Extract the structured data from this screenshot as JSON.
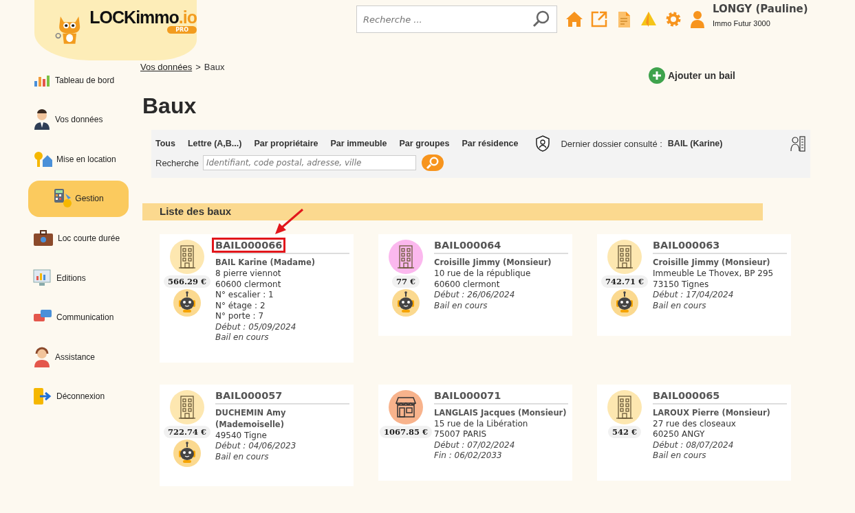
{
  "header": {
    "logo": {
      "brand": "LOCKimmo",
      "suffix": ".io",
      "badge": "PRO"
    },
    "search": {
      "placeholder": "Recherche ..."
    },
    "user": {
      "name": "LONGY (Pauline)",
      "company": "Immo Futur 3000"
    }
  },
  "sidebar": {
    "items": [
      {
        "label": "Tableau de bord",
        "selected": false
      },
      {
        "label": "Vos données",
        "selected": false
      },
      {
        "label": "Mise en location",
        "selected": false
      },
      {
        "label": "Gestion",
        "selected": true
      },
      {
        "label": "Loc courte durée",
        "selected": false
      },
      {
        "label": "Editions",
        "selected": false
      },
      {
        "label": "Communication",
        "selected": false
      },
      {
        "label": "Assistance",
        "selected": false
      },
      {
        "label": "Déconnexion",
        "selected": false
      }
    ]
  },
  "breadcrumb": {
    "link": "Vos données",
    "separator": ">",
    "current": "Baux"
  },
  "add_button": "Ajouter un bail",
  "title": "Baux",
  "filters": {
    "tabs": [
      "Tous",
      "Lettre (A,B...)",
      "Par propriétaire",
      "Par immeuble",
      "Par groupes",
      "Par résidence"
    ],
    "last_label": "Dernier dossier consulté :",
    "last_value": "BAIL (Karine)",
    "search_label": "Recherche",
    "search_placeholder": "Identifiant, code postal, adresse, ville"
  },
  "list_title": "Liste des baux",
  "cards": [
    {
      "id": "BAIL000066",
      "highlighted": true,
      "kind": "building",
      "color": "#fde7b0",
      "price": "566.29 €",
      "robot": true,
      "tenant": "BAIL Karine (Madame)",
      "lines": [
        "8 pierre viennot",
        "60600 clermont",
        "N° escalier : 1",
        "N° étage : 2",
        "N° porte : 7"
      ],
      "notes": [
        "Début : 05/09/2024",
        "Bail en cours"
      ]
    },
    {
      "id": "BAIL000064",
      "highlighted": false,
      "kind": "building",
      "color": "#fbb8ee",
      "price": "77 €",
      "robot": true,
      "tenant": "Croisille Jimmy (Monsieur)",
      "lines": [
        "10 rue de la république",
        "60600 clermont"
      ],
      "notes": [
        "Début : 26/06/2024",
        "Bail en cours"
      ]
    },
    {
      "id": "BAIL000063",
      "highlighted": false,
      "kind": "building",
      "color": "#fde7b0",
      "price": "742.71 €",
      "robot": true,
      "tenant": "Croisille Jimmy (Monsieur)",
      "lines": [
        "Immeuble Le Thovex, BP 295",
        "73150 Tignes"
      ],
      "notes": [
        "Début : 17/04/2024",
        "Bail en cours"
      ]
    },
    {
      "id": "BAIL000057",
      "highlighted": false,
      "kind": "building",
      "color": "#fde7b0",
      "price": "722.74 €",
      "robot": true,
      "tenant": "DUCHEMIN Amy (Mademoiselle)",
      "lines": [
        "49540 Tigne"
      ],
      "notes": [
        "Début : 04/06/2023",
        "Bail en cours"
      ]
    },
    {
      "id": "BAIL000071",
      "highlighted": false,
      "kind": "shop",
      "color": "#f8b38c",
      "price": "1067.85 €",
      "robot": false,
      "tenant": "LANGLAIS Jacques (Monsieur)",
      "lines": [
        "15 rue de la Libération",
        "75007 PARIS"
      ],
      "notes": [
        "Début : 07/02/2024",
        "Fin : 06/02/2033"
      ]
    },
    {
      "id": "BAIL000065",
      "highlighted": false,
      "kind": "building",
      "color": "#fde7b0",
      "price": "542 €",
      "robot": false,
      "tenant": "LAROUX Pierre (Monsieur)",
      "lines": [
        "27 rue des closeaux",
        "60250 ANGY"
      ],
      "notes": [
        "Début : 08/07/2024",
        "Bail en cours"
      ]
    }
  ]
}
